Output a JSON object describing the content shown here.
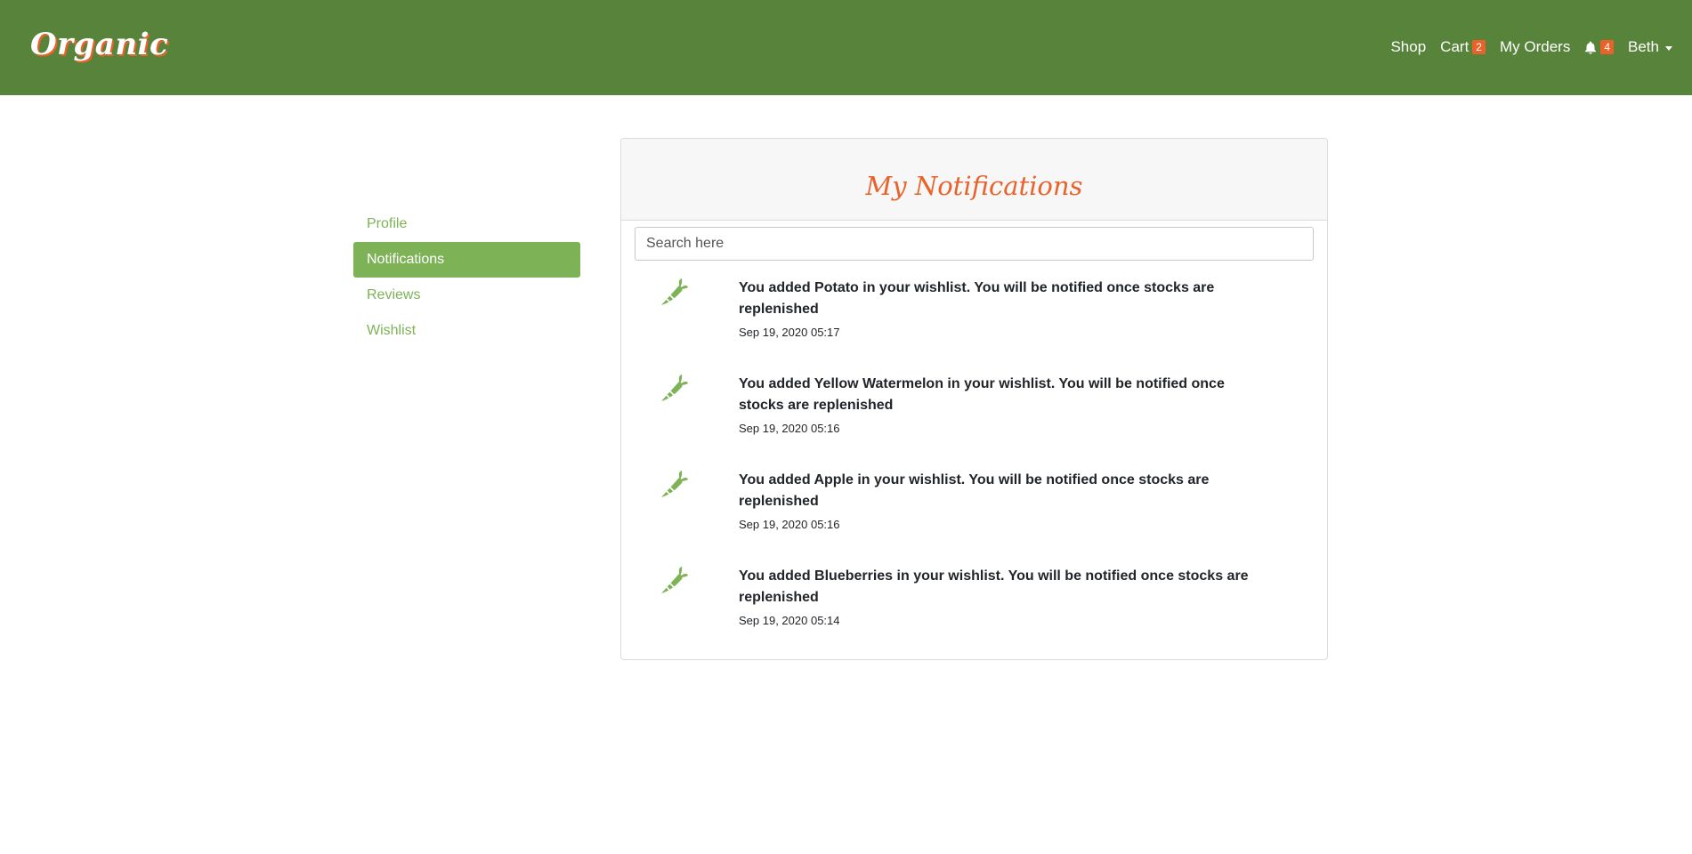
{
  "brand": "Organic",
  "nav": {
    "shop": "Shop",
    "cart": "Cart",
    "cart_count": "2",
    "orders": "My Orders",
    "notification_count": "4",
    "user": "Beth"
  },
  "sidebar": {
    "items": [
      {
        "label": "Profile"
      },
      {
        "label": "Notifications"
      },
      {
        "label": "Reviews"
      },
      {
        "label": "Wishlist"
      }
    ]
  },
  "main": {
    "title": "My Notifications",
    "search_placeholder": "Search here",
    "notifications": [
      {
        "message": "You added Potato in your wishlist. You will be notified once stocks are replenished",
        "time": "Sep 19, 2020 05:17"
      },
      {
        "message": "You added Yellow Watermelon in your wishlist. You will be notified once stocks are replenished",
        "time": "Sep 19, 2020 05:16"
      },
      {
        "message": "You added Apple in your wishlist. You will be notified once stocks are replenished",
        "time": "Sep 19, 2020 05:16"
      },
      {
        "message": "You added Blueberries in your wishlist. You will be notified once stocks are replenished",
        "time": "Sep 19, 2020 05:14"
      }
    ]
  },
  "colors": {
    "navbar": "#57833b",
    "accent_green": "#7db257",
    "accent_orange": "#e8622a"
  },
  "icons": {
    "bell": "bell-icon",
    "notification": "carrot-icon",
    "user_menu": "caret-down-icon"
  }
}
